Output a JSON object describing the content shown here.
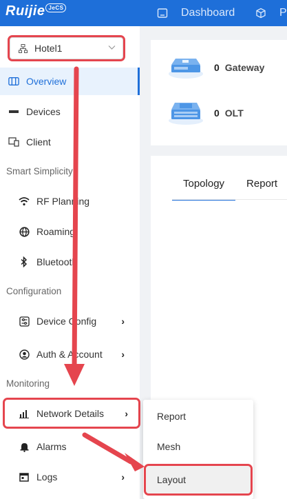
{
  "topbar": {
    "logo_text": "Ruijie",
    "logo_badge": "JeCS",
    "nav": [
      {
        "label": "Dashboard",
        "icon": "dashboard-icon"
      },
      {
        "label": "P",
        "icon": "cube-icon"
      }
    ]
  },
  "sidebar": {
    "site_select": {
      "value": "Hotel1",
      "icon": "network-icon"
    },
    "items": [
      {
        "label": "Overview",
        "icon": "overview-icon",
        "active": true
      },
      {
        "label": "Devices",
        "icon": "devices-icon"
      },
      {
        "label": "Client",
        "icon": "client-icon"
      }
    ],
    "sections": [
      {
        "title": "Smart Simplicity",
        "items": [
          {
            "label": "RF Planning",
            "icon": "wifi-icon"
          },
          {
            "label": "Roaming",
            "icon": "globe-icon"
          },
          {
            "label": "Bluetooth",
            "icon": "bluetooth-icon"
          }
        ]
      },
      {
        "title": "Configuration",
        "items": [
          {
            "label": "Device Config",
            "icon": "sliders-icon",
            "has_arrow": true
          },
          {
            "label": "Auth & Account",
            "icon": "user-circle-icon",
            "has_arrow": true
          }
        ]
      },
      {
        "title": "Monitoring",
        "items": [
          {
            "label": "Network Details",
            "icon": "chart-bars-icon",
            "has_arrow": true
          },
          {
            "label": "Alarms",
            "icon": "bell-icon"
          },
          {
            "label": "Logs",
            "icon": "calendar-icon",
            "has_arrow": true
          }
        ]
      }
    ],
    "arrow_glyph": "›"
  },
  "main": {
    "devices": [
      {
        "count": "0",
        "name": "Gateway",
        "icon": "gateway-device-icon"
      },
      {
        "count": "0",
        "name": "OLT",
        "icon": "olt-device-icon"
      }
    ],
    "tabs": [
      {
        "label": "Topology",
        "active": true
      },
      {
        "label": "Report"
      }
    ]
  },
  "submenu": {
    "items": [
      {
        "label": "Report"
      },
      {
        "label": "Mesh"
      },
      {
        "label": "Layout",
        "hovered": true
      }
    ]
  },
  "colors": {
    "primary": "#1e6fd9",
    "annotation": "#e5454e"
  }
}
